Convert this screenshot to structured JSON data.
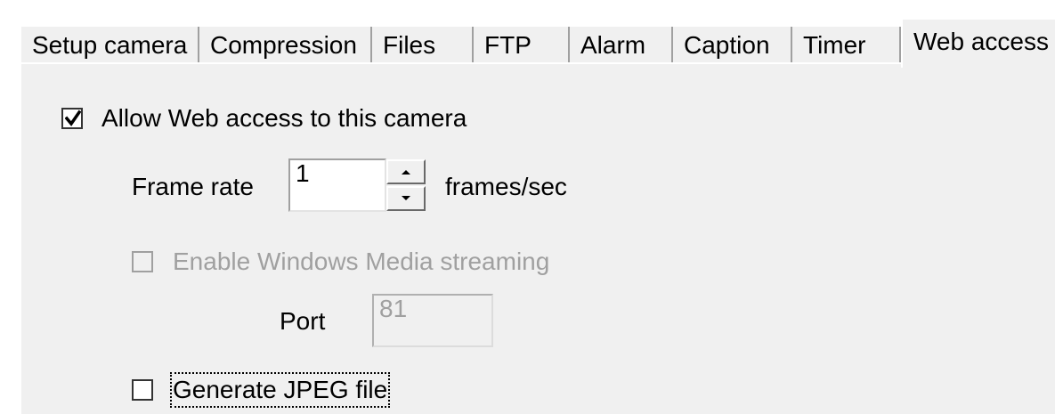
{
  "tabs": [
    {
      "label": "Setup camera",
      "active": false
    },
    {
      "label": "Compression",
      "active": false
    },
    {
      "label": "Files",
      "active": false
    },
    {
      "label": "FTP",
      "active": false
    },
    {
      "label": "Alarm",
      "active": false
    },
    {
      "label": "Caption",
      "active": false
    },
    {
      "label": "Timer",
      "active": false
    },
    {
      "label": "Web access",
      "active": true
    }
  ],
  "web_access": {
    "allow_label": "Allow Web access to this camera",
    "allow_checked": true,
    "frame_rate_label": "Frame rate",
    "frame_rate_value": "1",
    "frame_rate_unit": "frames/sec",
    "wms_label": "Enable Windows Media streaming",
    "wms_checked": false,
    "wms_enabled": false,
    "port_label": "Port",
    "port_value": "81",
    "jpeg_label": "Generate JPEG file",
    "jpeg_checked": false
  },
  "icons": {
    "check": "check-icon",
    "spin_up": "spin-up-arrow-icon",
    "spin_down": "spin-down-arrow-icon"
  },
  "colors": {
    "panel_bg": "#f0f0f0",
    "disabled_text": "#a0a0a0"
  }
}
